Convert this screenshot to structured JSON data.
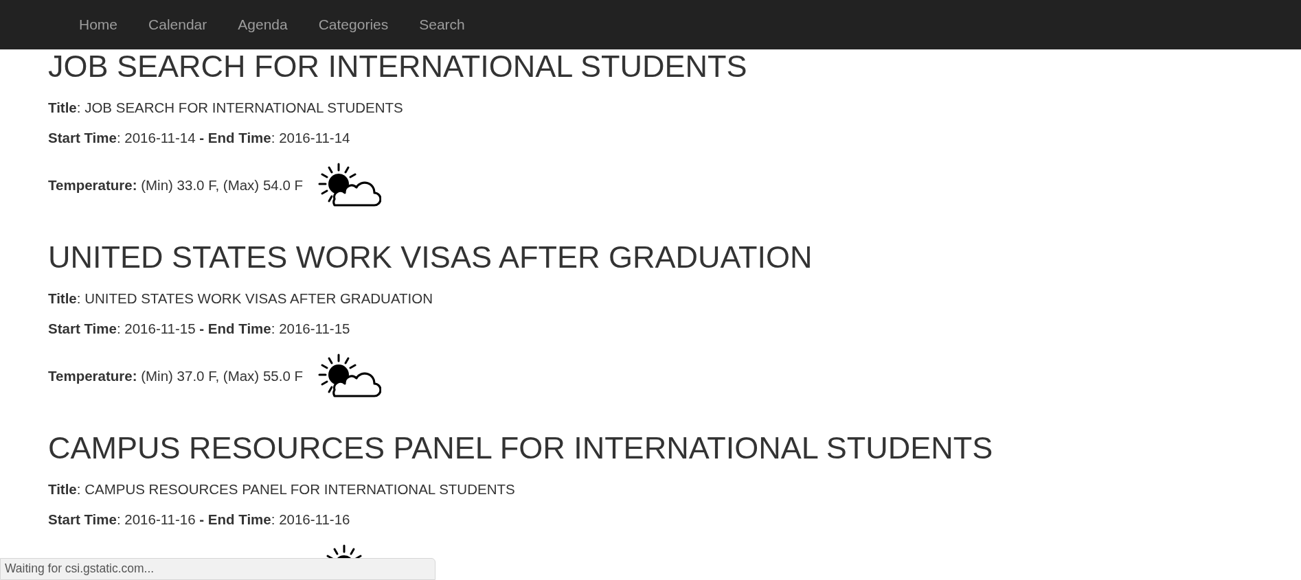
{
  "nav": {
    "items": [
      {
        "label": "Home"
      },
      {
        "label": "Calendar"
      },
      {
        "label": "Agenda"
      },
      {
        "label": "Categories"
      },
      {
        "label": "Search"
      }
    ]
  },
  "events": [
    {
      "heading": "JOB SEARCH FOR INTERNATIONAL STUDENTS",
      "title": "**Title**: JOB SEARCH FOR INTERNATIONAL STUDENTS",
      "times": "**Start Time**: 2016-11-14 **- End Time**: 2016-11-14",
      "temperature": "**Temperature:** (Min) 33.0 F, (Max) 54.0 F"
    },
    {
      "heading": "UNITED STATES WORK VISAS AFTER GRADUATION",
      "title": "**Title**: UNITED STATES WORK VISAS AFTER GRADUATION",
      "times": "**Start Time**: 2016-11-15 **- End Time**: 2016-11-15",
      "temperature": "**Temperature:** (Min) 37.0 F, (Max) 55.0 F"
    },
    {
      "heading": "CAMPUS RESOURCES PANEL FOR INTERNATIONAL STUDENTS",
      "title": "**Title**: CAMPUS RESOURCES PANEL FOR INTERNATIONAL STUDENTS",
      "times": "**Start Time**: 2016-11-16 **- End Time**: 2016-11-16"
    }
  ],
  "status_bar": {
    "text": "Waiting for csi.gstatic.com..."
  }
}
